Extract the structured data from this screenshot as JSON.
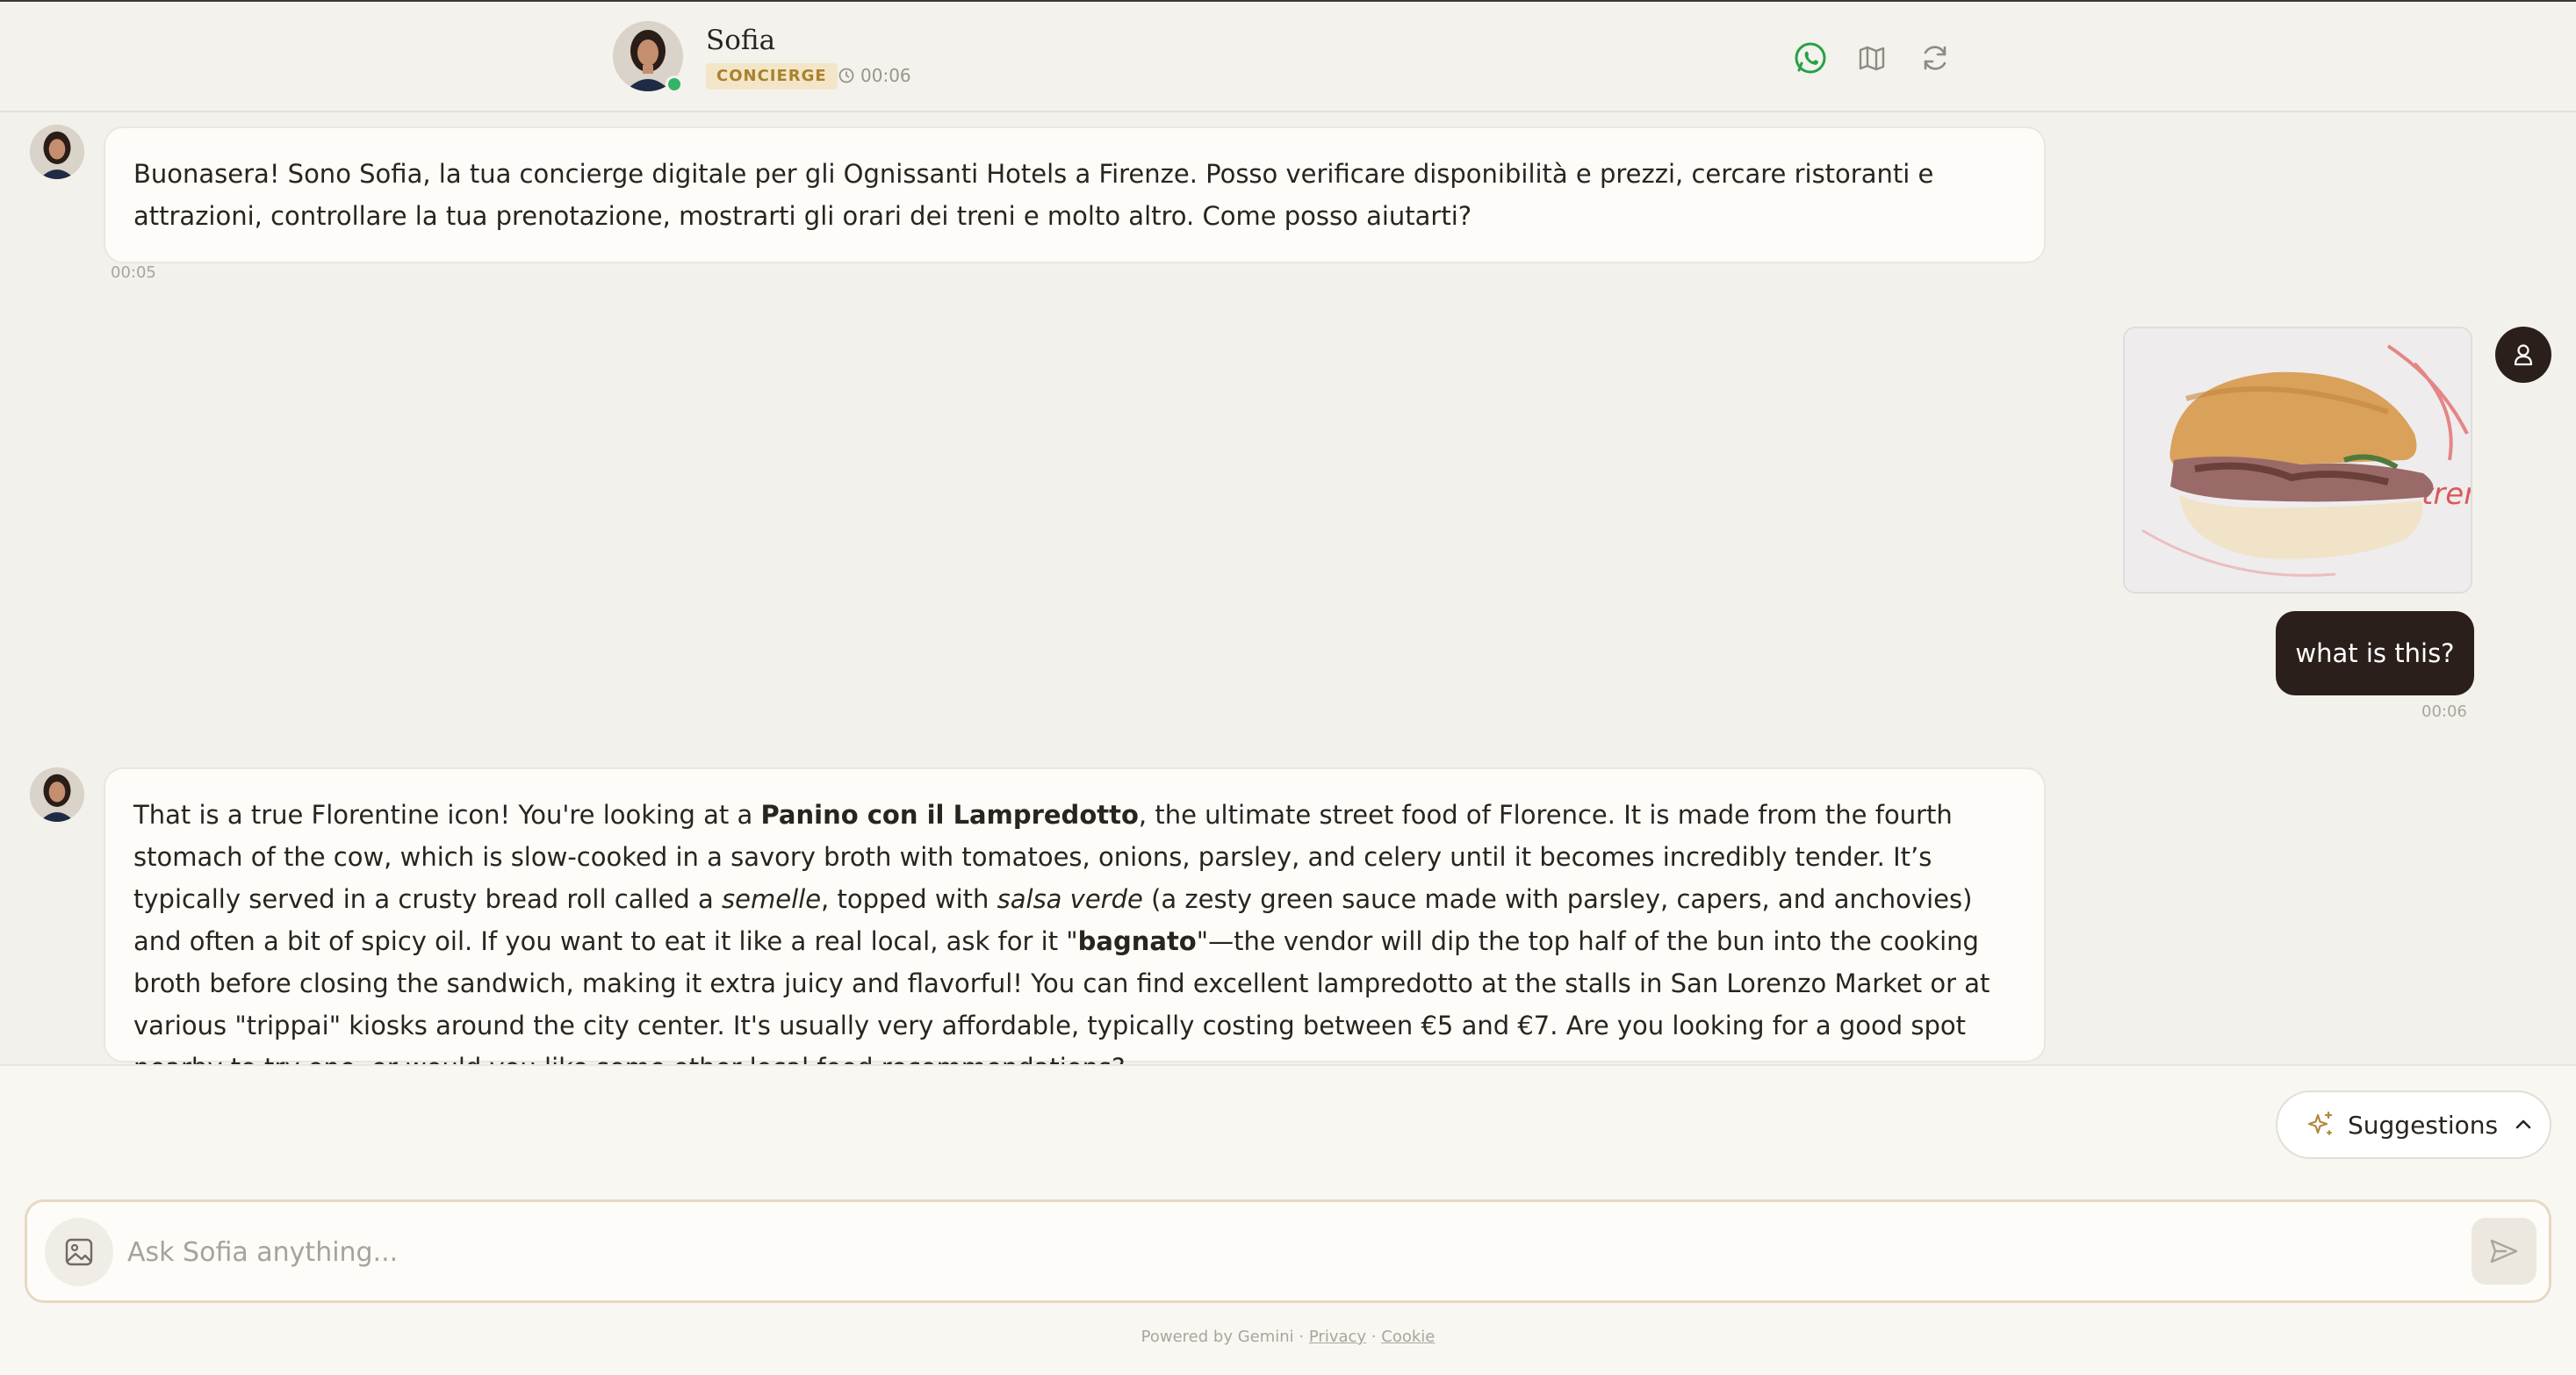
{
  "header": {
    "agent_name": "Sofia",
    "role_badge": "CONCIERGE",
    "time": "00:06",
    "online": true,
    "actions": [
      "whatsapp-icon",
      "map-icon",
      "refresh-icon"
    ]
  },
  "messages": [
    {
      "sender": "agent",
      "text": "Buonasera! Sono Sofia, la tua concierge digitale per gli Ognissanti Hotels a Firenze. Posso verificare disponibilità e prezzi, cercare ristoranti e attrazioni, controllare la tua prenotazione, mostrarti gli orari dei treni e molto altro. Come posso aiutarti?",
      "time": "00:05"
    },
    {
      "sender": "user",
      "image": "panino-con-lampredotto-photo",
      "text": "what is this?",
      "time": "00:06"
    },
    {
      "sender": "agent",
      "parts": [
        "That is a true Florentine icon! You're looking at a ",
        "Panino con il Lampredotto",
        ", the ultimate street food of Florence. It is made from the fourth stomach of the cow, which is slow-cooked in a savory broth with tomatoes, onions, parsley, and celery until it becomes incredibly tender. It’s typically served in a crusty bread roll called a ",
        "semelle",
        ", topped with ",
        "salsa verde",
        " (a zesty green sauce made with parsley, capers, and anchovies) and often a bit of spicy oil. If you want to eat it like a real local, ask for it \"",
        "bagnato",
        "\"—the vendor will dip the top half of the bun into the cooking broth before closing the sandwich, making it extra juicy and flavorful! You can find excellent lampredotto at the stalls in San Lorenzo Market or at various \"trippai\" kiosks around the city center. It's usually very affordable, typically costing between €5 and €7. Are you looking for a good spot nearby to try one, or would you like some other local food recommendations?"
      ]
    }
  ],
  "suggestions": {
    "label": "Suggestions"
  },
  "composer": {
    "placeholder": "Ask Sofia anything..."
  },
  "footer": {
    "powered_by": "Powered by Gemini",
    "separator": "·",
    "privacy": "Privacy",
    "cookie": "Cookie"
  },
  "colors": {
    "background": "#f3f1ec",
    "user_bubble": "#2a1f1b",
    "badge_bg": "#f3e6c8",
    "badge_text": "#a8822c",
    "online": "#33b567",
    "whatsapp": "#25a244"
  }
}
